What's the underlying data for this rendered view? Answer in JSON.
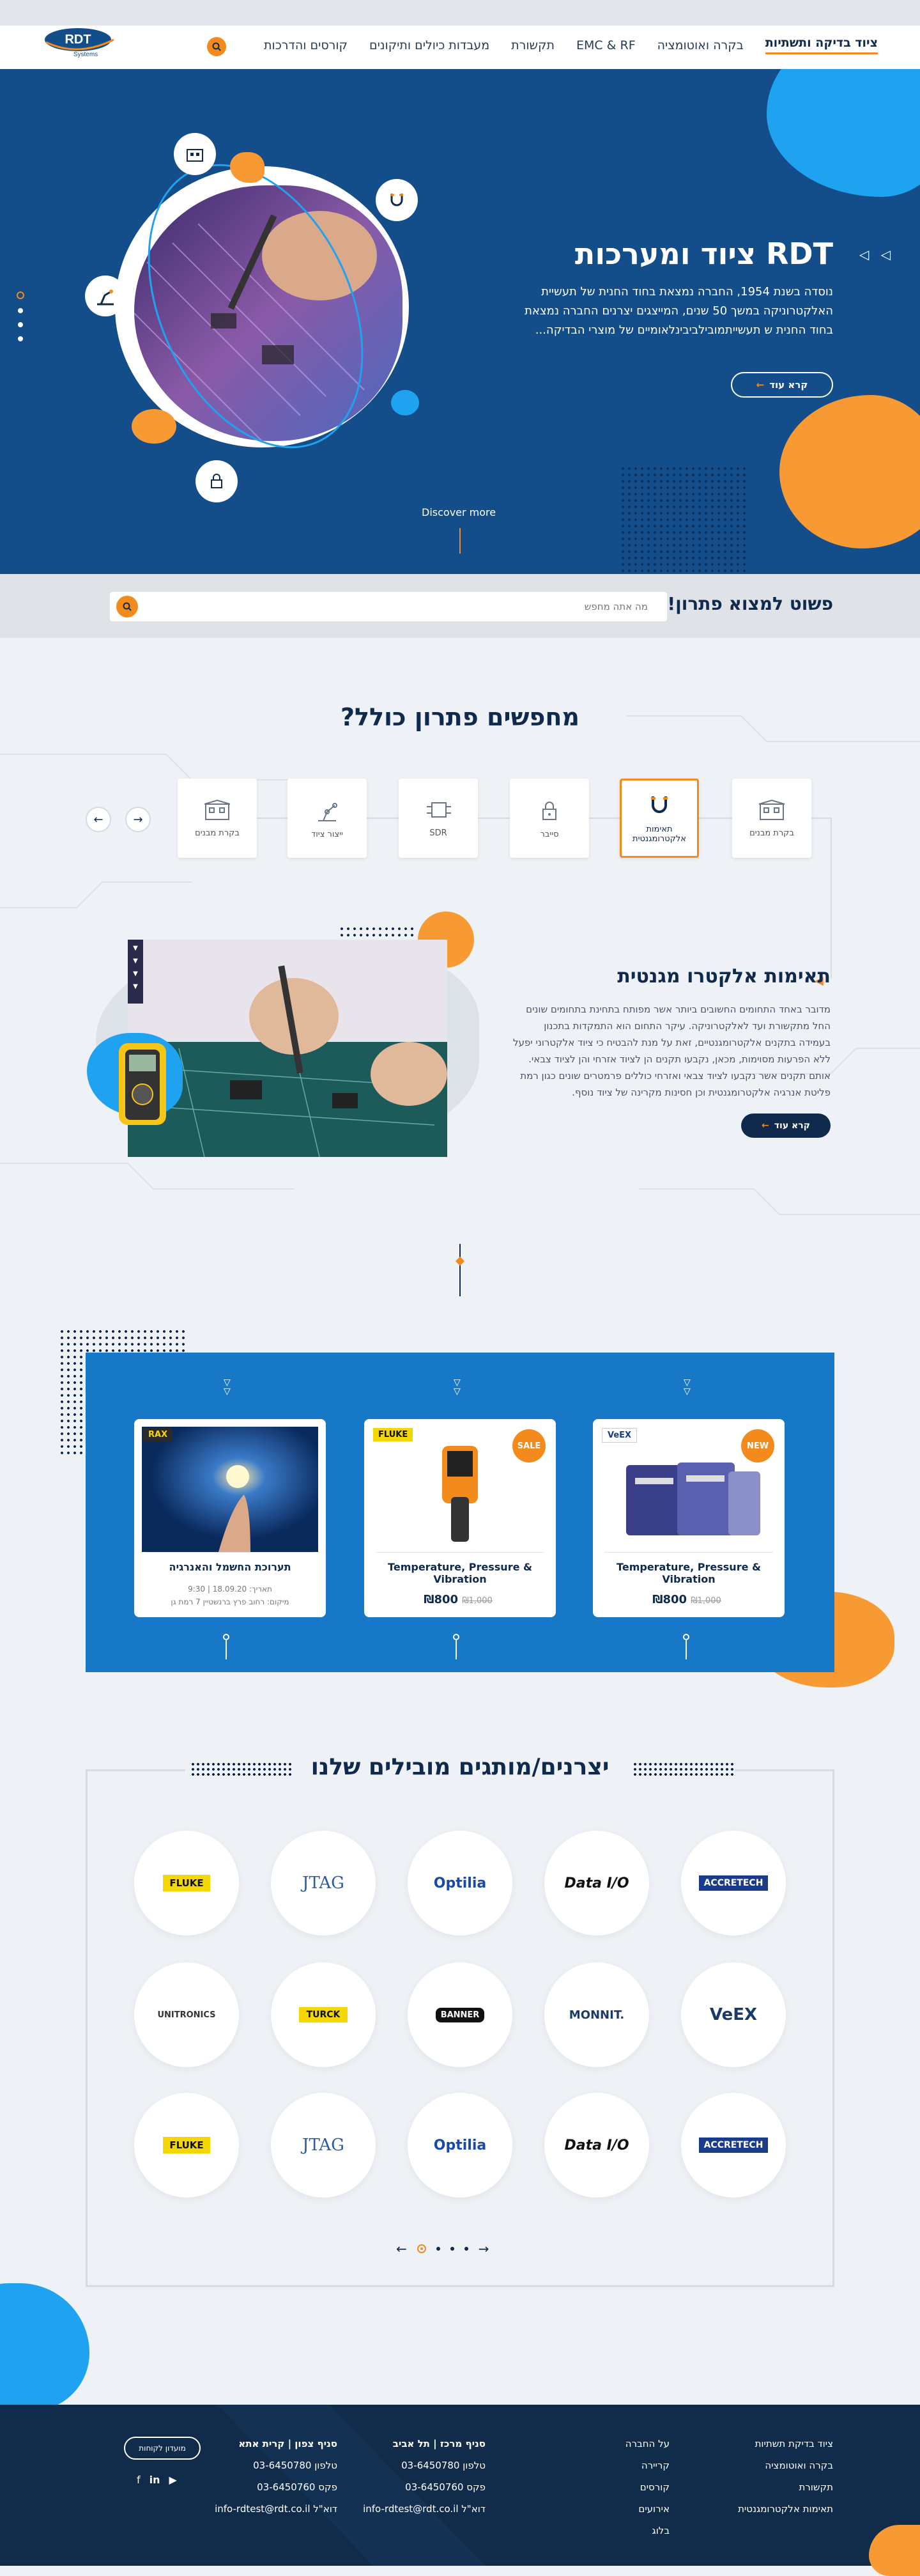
{
  "brand": {
    "logo_text": "RDT",
    "logo_sub": "Systems"
  },
  "nav": {
    "items": [
      {
        "label": "ציוד בדיקה ותשתיות",
        "active": true
      },
      {
        "label": "בקרה ואוטומציה"
      },
      {
        "label": "EMC & RF"
      },
      {
        "label": "תקשורת"
      },
      {
        "label": "מעבדות כיולים ותיקונים"
      },
      {
        "label": "קורסים והדרכות"
      }
    ],
    "search_icon": "search-icon"
  },
  "hero": {
    "title": "RDT ציוד ומערכות",
    "text": "נוסדה בשנת 1954, החברה נמצאת בחוד החנית של תעשיית האלקטרוניקה במשך 50 שנים, המייצגים יצרנים החברה נמצאת בחוד החנית ש תעשייתמובילביבינלאומיים של מוצרי הבדיקה...",
    "button": "קרא עוד",
    "discover": "Discover more",
    "arrows": "◁ ◁"
  },
  "search": {
    "label": "פשוט למצוא פתרון!",
    "placeholder": "מה אתה מחפש"
  },
  "solutions": {
    "title": "מחפשים פתרון כולל?",
    "categories": [
      {
        "label": "בקרת מבנים",
        "icon": "building-icon"
      },
      {
        "label": "תאימות אלקטרומגנטית",
        "icon": "magnet-icon",
        "active": true
      },
      {
        "label": "סייבר",
        "icon": "lock-icon"
      },
      {
        "label": "SDR",
        "icon": "circuit-icon"
      },
      {
        "label": "ייצור ציוד",
        "icon": "robot-arm-icon"
      },
      {
        "label": "בקרת מבנים",
        "icon": "building-icon"
      }
    ],
    "feature": {
      "title": "תאימות אלקטרו מגנטית",
      "text": "מדובר באחד התחומים החשובים ביותר אשר מפותח בתחינת בתחומים שונים החל מתקשורת ועד לאלקטרוניקה. עיקר התחום הוא התמקדות בתכנון בעמידה בתקנים אלקטרומגנטיים, זאת על מנת להבטיח כי ציוד אלקטרוני יפעל ללא הפרעות מסוימות, מכאן, נקבעו תקנים הן לציוד אזרחי והן לציוד צבאי. אותם תקנים אשר נקבעו לציוד צבאי ואזרחי כוללים פרמטרים שונים כגון רמת פליטת אנרגיה אלקטרומגנטית וכן חסינות מקרינה של ציוד נוסף.",
      "button": "קרא עוד"
    }
  },
  "products": [
    {
      "name": "Temperature, Pressure & Vibration",
      "price": "₪800",
      "old_price": "₪1,000",
      "badge": "NEW",
      "brand": "VeEX"
    },
    {
      "name": "Temperature, Pressure & Vibration",
      "price": "₪800",
      "old_price": "₪1,000",
      "badge": "SALE",
      "brand": "FLUKE"
    },
    {
      "name": "תערוכת החשמל והאנרגיה",
      "meta1": "תאריך: 18.09.20 | 9:30",
      "meta2": "מיקום: רחוב פרץ ברנשטיין 7 רמת גן",
      "brand": "RAX"
    }
  ],
  "brands": {
    "title": "יצרנים/מותגים מובילים שלנו",
    "rows": [
      [
        "ACCRETECH",
        "Data I/O",
        "Optilia",
        "JTAG",
        "FLUKE"
      ],
      [
        "VeEX",
        "MONNIT.",
        "BANNER",
        "TURCK",
        "UNITRONICS"
      ],
      [
        "ACCRETECH",
        "Data I/O",
        "Optilia",
        "JTAG",
        "FLUKE"
      ]
    ]
  },
  "footer": {
    "col1": [
      "ציוד בדיקת תשתיות",
      "בקרה ואוטומציה",
      "תקשורת",
      "תאימות אלקטרומגנטית"
    ],
    "col2": [
      "על החברה",
      "קריירה",
      "קורסים",
      "אירועים",
      "בלוג"
    ],
    "branch1": {
      "title": "סניף מרכז | תל אביב",
      "phone": "טלפון 03-6450780",
      "fax": "פקס 03-6450760",
      "email": "דוא\"ל info-rdtest@rdt.co.il"
    },
    "branch2": {
      "title": "סניף צפון | קרית אתא",
      "phone": "טלפון 03-6450780",
      "fax": "פקס 03-6450760",
      "email": "דוא\"ל info-rdtest@rdt.co.il"
    },
    "button": "מועדון לקוחות"
  },
  "colors": {
    "primary": "#134d8a",
    "accent": "#f28a1c",
    "sky": "#1fa3f0",
    "panel": "#1778c7",
    "footer": "#112c4b"
  }
}
